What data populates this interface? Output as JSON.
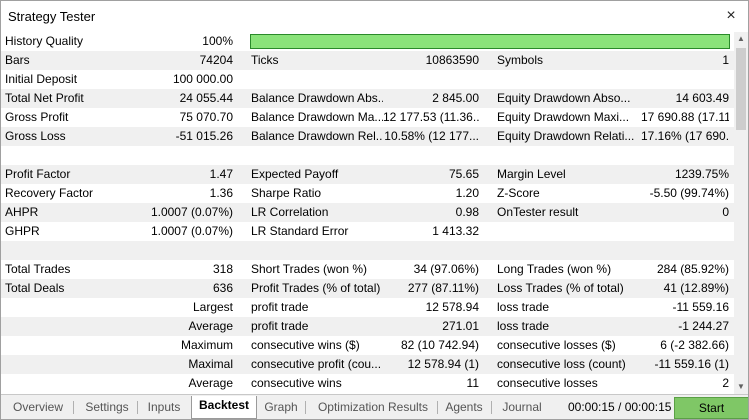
{
  "window": {
    "title": "Strategy Tester",
    "close_icon": "×"
  },
  "report": {
    "history_quality": {
      "label": "History Quality",
      "value": "100%",
      "bar_fraction": 1.0,
      "bar_color": "#8ae37a"
    },
    "rows": [
      {
        "alt": true,
        "cells": [
          "Bars",
          "74204",
          "Ticks",
          "10863590",
          "Symbols",
          "1"
        ]
      },
      {
        "alt": false,
        "cells": [
          "Initial Deposit",
          "100 000.00",
          "",
          "",
          "",
          ""
        ]
      },
      {
        "alt": true,
        "cells": [
          "Total Net Profit",
          "24 055.44",
          "Balance Drawdown Abs...",
          "2 845.00",
          "Equity Drawdown Abso...",
          "14 603.49"
        ]
      },
      {
        "alt": false,
        "cells": [
          "Gross Profit",
          "75 070.70",
          "Balance Drawdown Ma...",
          "12 177.53 (11.36...",
          "Equity Drawdown Maxi...",
          "17 690.88 (17.11..."
        ]
      },
      {
        "alt": true,
        "cells": [
          "Gross Loss",
          "-51 015.26",
          "Balance Drawdown Rel...",
          "10.58% (12 177...",
          "Equity Drawdown Relati...",
          "17.16% (17 690..."
        ]
      },
      {
        "alt": false,
        "cells": [
          "",
          "",
          "",
          "",
          "",
          ""
        ]
      },
      {
        "alt": true,
        "cells": [
          "Profit Factor",
          "1.47",
          "Expected Payoff",
          "75.65",
          "Margin Level",
          "1239.75%"
        ]
      },
      {
        "alt": false,
        "cells": [
          "Recovery Factor",
          "1.36",
          "Sharpe Ratio",
          "1.20",
          "Z-Score",
          "-5.50 (99.74%)"
        ]
      },
      {
        "alt": true,
        "cells": [
          "AHPR",
          "1.0007 (0.07%)",
          "LR Correlation",
          "0.98",
          "OnTester result",
          "0"
        ]
      },
      {
        "alt": false,
        "cells": [
          "GHPR",
          "1.0007 (0.07%)",
          "LR Standard Error",
          "1 413.32",
          "",
          ""
        ]
      },
      {
        "alt": true,
        "cells": [
          "",
          "",
          "",
          "",
          "",
          ""
        ]
      },
      {
        "alt": false,
        "cells": [
          "Total Trades",
          "318",
          "Short Trades (won %)",
          "34 (97.06%)",
          "Long Trades (won %)",
          "284 (85.92%)"
        ]
      },
      {
        "alt": true,
        "cells": [
          "Total Deals",
          "636",
          "Profit Trades (% of total)",
          "277 (87.11%)",
          "Loss Trades (% of total)",
          "41 (12.89%)"
        ]
      },
      {
        "alt": false,
        "cells": [
          "",
          "Largest",
          "profit trade",
          "12 578.94",
          "loss trade",
          "-11 559.16"
        ]
      },
      {
        "alt": true,
        "cells": [
          "",
          "Average",
          "profit trade",
          "271.01",
          "loss trade",
          "-1 244.27"
        ]
      },
      {
        "alt": false,
        "cells": [
          "",
          "Maximum",
          "consecutive wins ($)",
          "82 (10 742.94)",
          "consecutive losses ($)",
          "6 (-2 382.66)"
        ]
      },
      {
        "alt": true,
        "cells": [
          "",
          "Maximal",
          "consecutive profit (cou...",
          "12 578.94 (1)",
          "consecutive loss (count)",
          "-11 559.16 (1)"
        ]
      },
      {
        "alt": false,
        "cells": [
          "",
          "Average",
          "consecutive wins",
          "11",
          "consecutive losses",
          "2"
        ]
      }
    ]
  },
  "scrollbar": {
    "up_icon": "▲",
    "down_icon": "▼"
  },
  "tabs": [
    {
      "label": "Overview",
      "active": false
    },
    {
      "label": "Settings",
      "active": false
    },
    {
      "label": "Inputs",
      "active": false
    },
    {
      "label": "Backtest",
      "active": true
    },
    {
      "label": "Graph",
      "active": false
    },
    {
      "label": "Optimization Results",
      "active": false
    },
    {
      "label": "Agents",
      "active": false
    },
    {
      "label": "Journal",
      "active": false
    }
  ],
  "status": {
    "timer": "00:00:15 / 00:00:15"
  },
  "start_button": {
    "label": "Start",
    "color": "#7fc766"
  }
}
